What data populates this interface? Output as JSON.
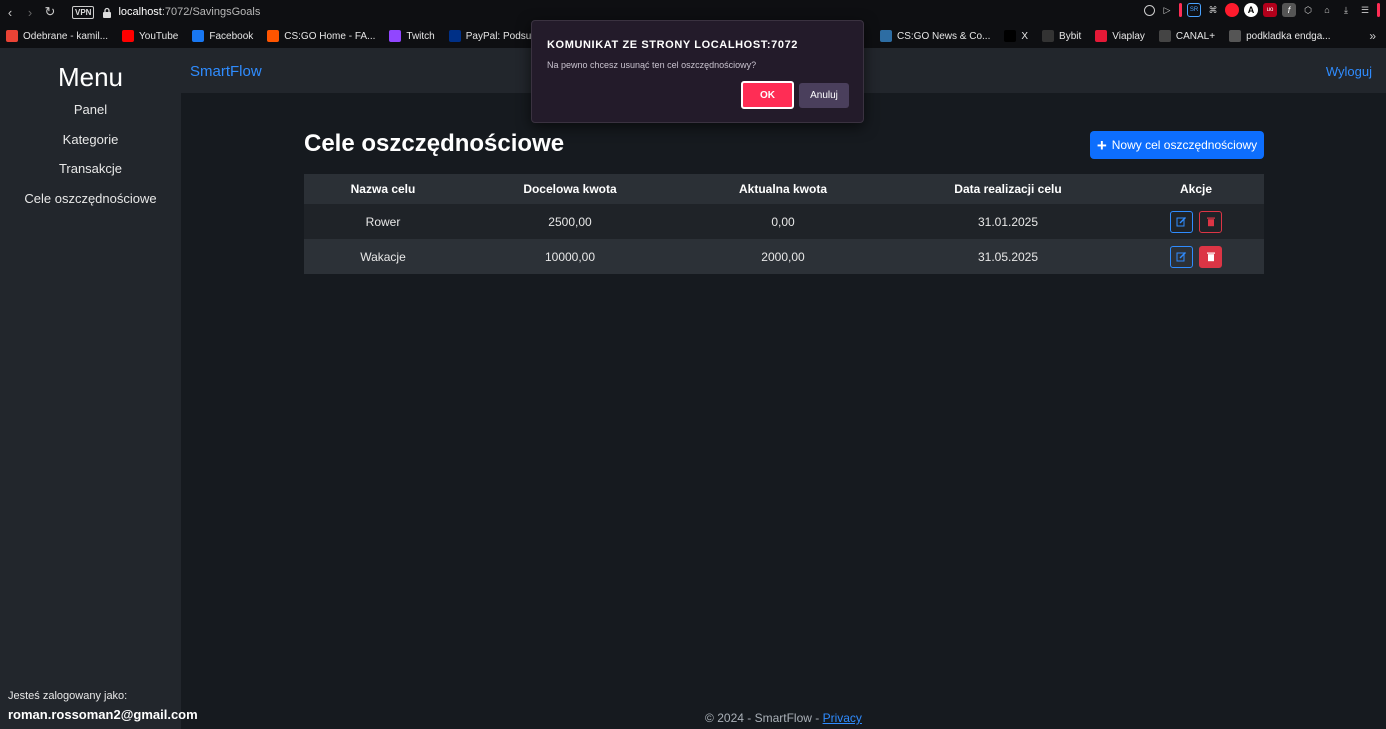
{
  "browser": {
    "url_host": "localhost",
    "url_path": ":7072/SavingsGoals",
    "vpn_label": "VPN",
    "bookmarks": [
      {
        "label": "Odebrane - kamil...",
        "icon": "gmail-icon",
        "color": "#ea4335"
      },
      {
        "label": "YouTube",
        "icon": "youtube-icon",
        "color": "#ff0000"
      },
      {
        "label": "Facebook",
        "icon": "facebook-icon",
        "color": "#1877f2"
      },
      {
        "label": "CS:GO Home - FA...",
        "icon": "faceit-icon",
        "color": "#ff5500"
      },
      {
        "label": "Twitch",
        "icon": "twitch-icon",
        "color": "#9146ff"
      },
      {
        "label": "PayPal: Podsumo...",
        "icon": "paypal-icon",
        "color": "#003087"
      }
    ],
    "bookmarks_right": [
      {
        "label": "CS:GO News & Co...",
        "icon": "hltv-icon",
        "color": "#2d6da3"
      },
      {
        "label": "X",
        "icon": "x-icon",
        "color": "#000000"
      },
      {
        "label": "Bybit",
        "icon": "bybit-icon",
        "color": "#333333"
      },
      {
        "label": "Viaplay",
        "icon": "viaplay-icon",
        "color": "#e51937"
      },
      {
        "label": "CANAL+",
        "icon": "canal-plus-icon",
        "color": "#444444"
      },
      {
        "label": "podkladka endga...",
        "icon": "gear-icon",
        "color": "#555555"
      }
    ]
  },
  "sidebar": {
    "title": "Menu",
    "items": [
      {
        "label": "Panel"
      },
      {
        "label": "Kategorie"
      },
      {
        "label": "Transakcje"
      },
      {
        "label": "Cele oszczędnościowe"
      }
    ],
    "logged_label": "Jesteś zalogowany jako:",
    "user_email": "roman.rossoman2@gmail.com"
  },
  "header": {
    "brand": "SmartFlow",
    "logout": "Wyloguj"
  },
  "main": {
    "title": "Cele oszczędnościowe",
    "new_button": "Nowy cel oszczędnościowy",
    "columns": [
      "Nazwa celu",
      "Docelowa kwota",
      "Aktualna kwota",
      "Data realizacji celu",
      "Akcje"
    ],
    "rows": [
      {
        "name": "Rower",
        "target": "2500,00",
        "current": "0,00",
        "date": "31.01.2025"
      },
      {
        "name": "Wakacje",
        "target": "10000,00",
        "current": "2000,00",
        "date": "31.05.2025"
      }
    ]
  },
  "footer": {
    "text": "© 2024 - SmartFlow - ",
    "privacy": "Privacy"
  },
  "dialog": {
    "title": "KOMUNIKAT ZE STRONY LOCALHOST:7072",
    "message": "Na pewno chcesz usunąć ten cel oszczędnościowy?",
    "ok": "OK",
    "cancel": "Anuluj"
  },
  "colors": {
    "accent": "#2f8cff",
    "primary_button": "#0d6efd",
    "danger": "#dc3545",
    "dialog_ok": "#ff2d55"
  }
}
